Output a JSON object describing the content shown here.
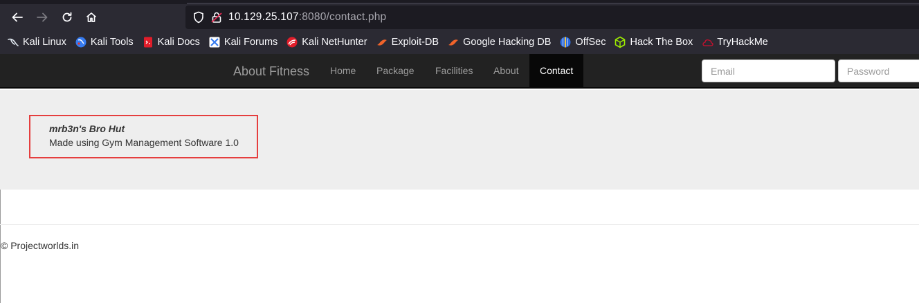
{
  "browser": {
    "url_host": "10.129.25.107",
    "url_rest": ":8080/contact.php",
    "bookmarks": [
      {
        "label": "Kali Linux",
        "icon": "kali-dragon-icon"
      },
      {
        "label": "Kali Tools",
        "icon": "kali-tools-icon"
      },
      {
        "label": "Kali Docs",
        "icon": "kali-docs-icon"
      },
      {
        "label": "Kali Forums",
        "icon": "kali-forums-icon"
      },
      {
        "label": "Kali NetHunter",
        "icon": "nethunter-icon"
      },
      {
        "label": "Exploit-DB",
        "icon": "exploit-db-icon"
      },
      {
        "label": "Google Hacking DB",
        "icon": "ghdb-icon"
      },
      {
        "label": "OffSec",
        "icon": "offsec-icon"
      },
      {
        "label": "Hack The Box",
        "icon": "hackthebox-icon"
      },
      {
        "label": "TryHackMe",
        "icon": "tryhackme-icon"
      }
    ]
  },
  "nav": {
    "brand": "About Fitness",
    "links": [
      "Home",
      "Package",
      "Facilities",
      "About",
      "Contact"
    ],
    "active": "Contact",
    "email_placeholder": "Email",
    "password_placeholder": "Password"
  },
  "content": {
    "title": "mrb3n's Bro Hut",
    "subtitle": "Made using Gym Management Software 1.0"
  },
  "footer": {
    "text": "© Projectworlds.in"
  },
  "colors": {
    "browser_bg": "#2b2a33",
    "navbar_bg": "#222222",
    "active_bg": "#080808",
    "jumbotron_bg": "#eeeeee",
    "highlight_border": "#e53e3e"
  }
}
